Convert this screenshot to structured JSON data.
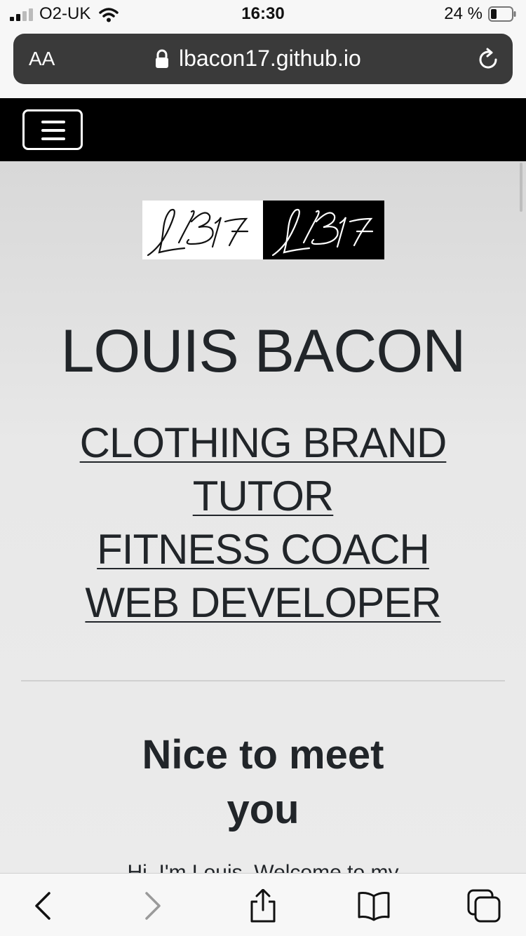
{
  "status_bar": {
    "carrier": "O2-UK",
    "time": "16:30",
    "battery": "24 %"
  },
  "address_bar": {
    "text_size_label": "AA",
    "url": "lbacon17.github.io"
  },
  "navbar": {
    "toggle_icon": "hamburger-icon"
  },
  "hero": {
    "logo_text": "LB17",
    "name": "LOUIS BACON",
    "roles": [
      "CLOTHING BRAND",
      "TUTOR",
      "FITNESS COACH",
      "WEB DEVELOPER"
    ]
  },
  "about": {
    "heading_line1": "Nice to meet",
    "heading_line2": "you",
    "intro": "Hi, I'm Louis. Welcome to my"
  },
  "toolbar": {
    "icons": [
      "back-icon",
      "forward-icon",
      "share-icon",
      "bookmarks-icon",
      "tabs-icon"
    ]
  },
  "colors": {
    "navbar": "#000000",
    "text": "#212529",
    "url_pill": "#3a3a3a"
  }
}
